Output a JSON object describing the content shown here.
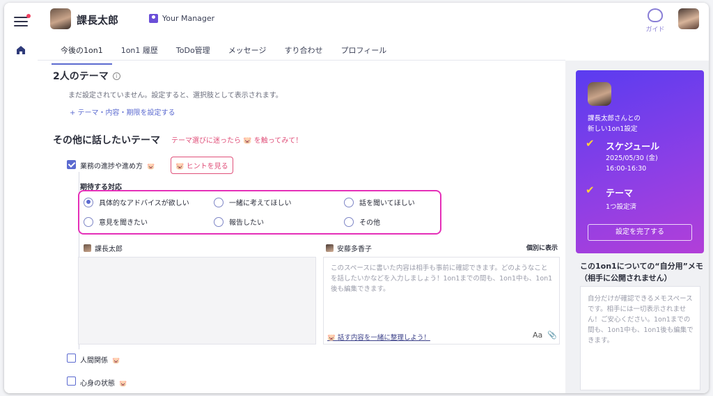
{
  "header": {
    "user_name": "課長太郎",
    "manager_label": "Your Manager",
    "guide_label": "ガイド"
  },
  "tabs": [
    {
      "label": "今後の1on1",
      "active": true
    },
    {
      "label": "1on1 履歴"
    },
    {
      "label": "ToDo管理"
    },
    {
      "label": "メッセージ"
    },
    {
      "label": "すり合わせ"
    },
    {
      "label": "プロフィール"
    }
  ],
  "theme2": {
    "title": "2人のテーマ",
    "info_icon": "i",
    "empty_text": "まだ設定されていません。設定すると、選択肢として表示されます。",
    "add_link": "+ テーマ・内容・期限を設定する"
  },
  "other": {
    "title": "その他に話したいテーマ",
    "hint": "テーマ選びに迷ったら 🐷 を触ってみて！",
    "items": [
      {
        "label": "業務の進捗や進め方",
        "checked": true
      },
      {
        "label": "人間関係",
        "checked": false
      },
      {
        "label": "心身の状態",
        "checked": false
      }
    ],
    "pig_icon": "🐷",
    "hint_button": "🐷 ヒントを見る",
    "expected_label": "期待する対応",
    "options": [
      {
        "label": "具体的なアドバイスが欲しい",
        "selected": true
      },
      {
        "label": "一緒に考えてほしい",
        "selected": false
      },
      {
        "label": "話を聞いてほしい",
        "selected": false
      },
      {
        "label": "意見を聞きたい",
        "selected": false
      },
      {
        "label": "報告したい",
        "selected": false
      },
      {
        "label": "その他",
        "selected": false
      }
    ]
  },
  "memo": {
    "left_name": "課長太郎",
    "right_name": "安藤多香子",
    "individual_label": "個別に表示",
    "placeholder": "このスペースに書いた内容は相手も事前に確認できます。どのようなことを話したいかなどを入力しましょう！1on1までの間も、1on1中も、1on1後も編集できます。",
    "footer_link": "話す内容を一緒に整理しよう！",
    "format_icon": "Aa",
    "attach_icon": "📎"
  },
  "card": {
    "line1": "課長太郎さんとの",
    "line2": "新しい1on1設定",
    "check_mark": "✔",
    "schedule_title": "スケジュール",
    "date": "2025/05/30 (金)",
    "time": "16:00-16:30",
    "theme_title": "テーマ",
    "theme_status": "1つ設定済",
    "button": "設定を完了する"
  },
  "self_memo": {
    "title": "この1on1についての“自分用”メモ（相手に公開されません）",
    "placeholder": "自分だけが確認できるメモスペースです。相手には一切表示されません！ご安心ください。1on1までの間も、1on1中も、1on1後も編集できます。"
  }
}
